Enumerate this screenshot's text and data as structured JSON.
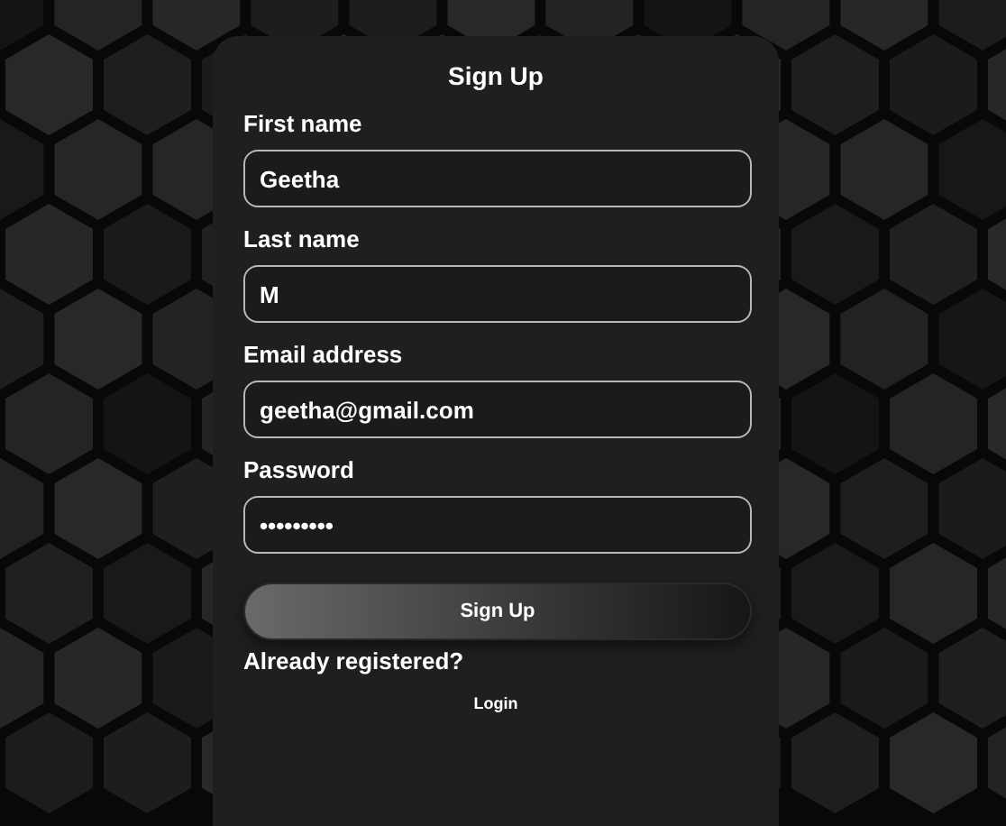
{
  "form": {
    "title": "Sign Up",
    "fields": [
      {
        "label": "First name",
        "value": "Geetha"
      },
      {
        "label": "Last name",
        "value": "M"
      },
      {
        "label": "Email address",
        "value": "geetha@gmail.com"
      },
      {
        "label": "Password",
        "value": "•••••••••"
      }
    ],
    "submit": "Sign Up",
    "prompt": "Already registered?",
    "link": "Login"
  }
}
